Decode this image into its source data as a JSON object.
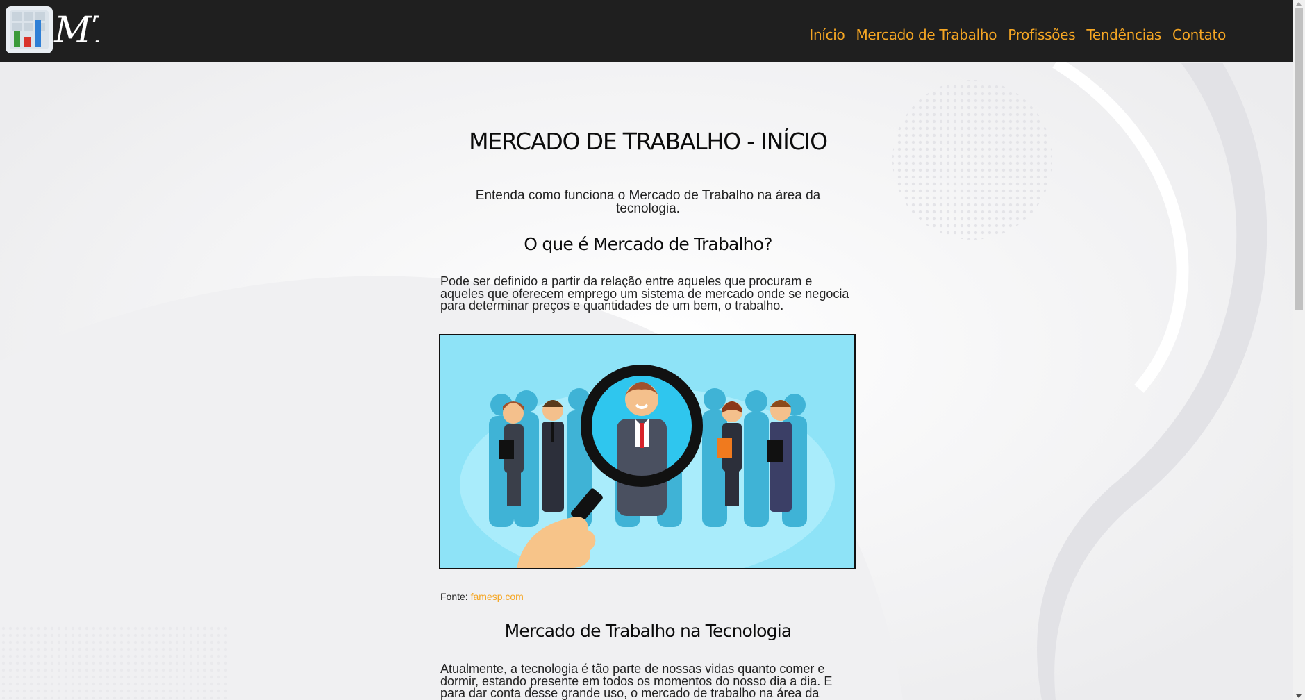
{
  "header": {
    "logo_text": "MT",
    "nav": [
      "Início",
      "Mercado de Trabalho",
      "Profissões",
      "Tendências",
      "Contato"
    ]
  },
  "main": {
    "title": "MERCADO DE TRABALHO - INÍCIO",
    "subtitle": "Entenda como funciona o Mercado de Trabalho na área da tecnologia.",
    "section1": {
      "heading": "O que é Mercado de Trabalho?",
      "text": "Pode ser definido a partir da relação entre aqueles que procuram e aqueles que oferecem emprego um sistema de mercado onde se negocia para determinar preços e quantidades de um bem, o trabalho."
    },
    "figure_caption": {
      "prefix": "Fonte: ",
      "link": "famesp.com"
    },
    "section2": {
      "heading": "Mercado de Trabalho na Tecnologia",
      "text": "Atualmente, a tecnologia é tão parte de nossas vidas quanto comer e dormir, estando presente em todos os momentos do nosso dia a dia. E para dar conta desse grande uso, o mercado de trabalho na área da"
    }
  },
  "colors": {
    "header_bg": "#1f1f1f",
    "accent": "#f5a623",
    "figure_bg": "#8ee3f7"
  },
  "icons": [
    "chart-logo-icon",
    "magnifier-illustration"
  ]
}
